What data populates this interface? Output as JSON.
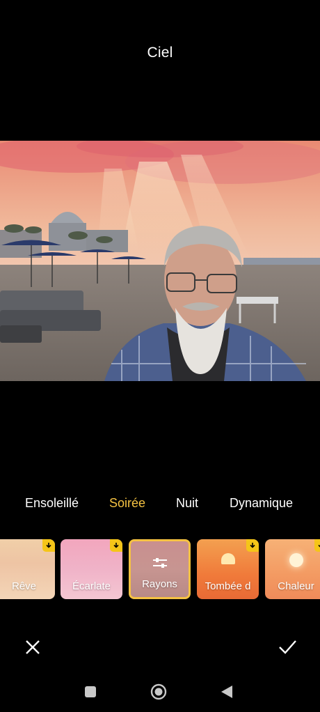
{
  "header": {
    "title": "Ciel"
  },
  "tabs": [
    {
      "label": "Ensoleillé",
      "active": false
    },
    {
      "label": "Soirée",
      "active": true
    },
    {
      "label": "Nuit",
      "active": false
    },
    {
      "label": "Dynamique",
      "active": false
    }
  ],
  "filters": [
    {
      "label": "Rêve",
      "download": true,
      "selected": false
    },
    {
      "label": "Écarlate",
      "download": true,
      "selected": false
    },
    {
      "label": "Rayons",
      "download": false,
      "selected": true,
      "icon": "sliders-icon"
    },
    {
      "label": "Tombée d",
      "download": true,
      "selected": false
    },
    {
      "label": "Chaleur",
      "download": true,
      "selected": false
    }
  ],
  "actions": {
    "cancel_icon": "close-icon",
    "confirm_icon": "check-icon"
  },
  "colors": {
    "accent": "#f5c242",
    "badge": "#f5c518",
    "background": "#000000"
  },
  "navbar": {
    "icons": [
      "recents-square-icon",
      "home-circle-icon",
      "back-triangle-icon"
    ]
  }
}
